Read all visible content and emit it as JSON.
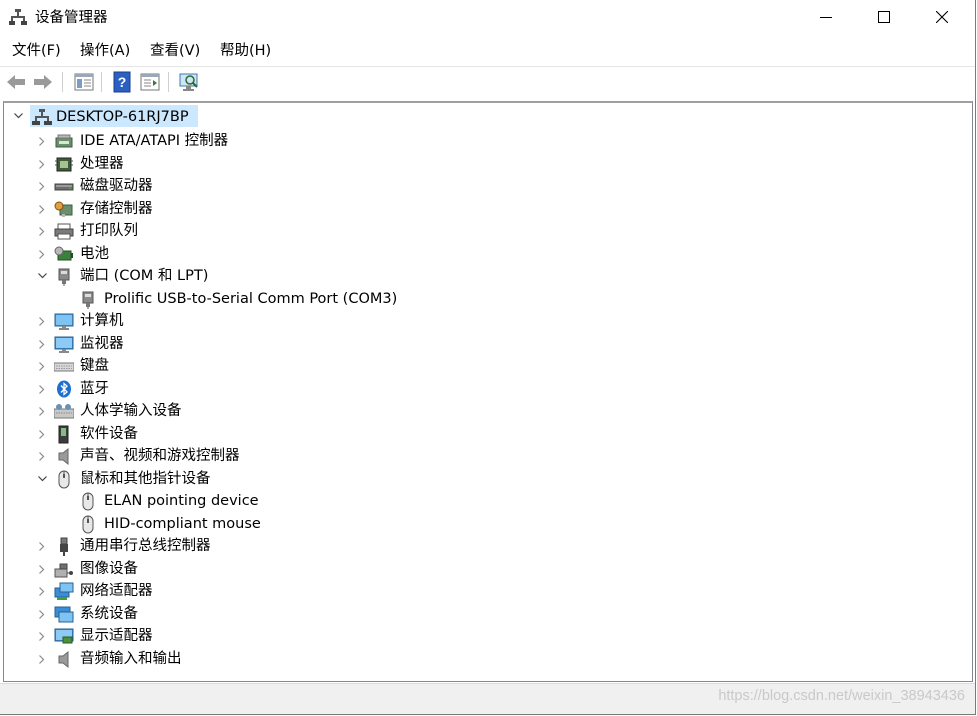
{
  "window": {
    "title": "设备管理器"
  },
  "menu": [
    "文件(F)",
    "操作(A)",
    "查看(V)",
    "帮助(H)"
  ],
  "toolbar": [
    {
      "name": "back-icon"
    },
    {
      "name": "forward-icon"
    },
    {
      "name": "properties-icon"
    },
    {
      "name": "help-icon"
    },
    {
      "name": "run-icon"
    },
    {
      "name": "scan-hardware-icon"
    }
  ],
  "tree": {
    "root": "DESKTOP-61RJ7BP",
    "items": [
      {
        "label": "IDE ATA/ATAPI 控制器",
        "icon": "ide-controller-icon",
        "expanded": false
      },
      {
        "label": "处理器",
        "icon": "processor-icon",
        "expanded": false
      },
      {
        "label": "磁盘驱动器",
        "icon": "disk-drive-icon",
        "expanded": false
      },
      {
        "label": "存储控制器",
        "icon": "storage-controller-icon",
        "expanded": false
      },
      {
        "label": "打印队列",
        "icon": "printer-icon",
        "expanded": false
      },
      {
        "label": "电池",
        "icon": "battery-icon",
        "expanded": false
      },
      {
        "label": "端口 (COM 和 LPT)",
        "icon": "port-icon",
        "expanded": true,
        "children": [
          {
            "label": "Prolific USB-to-Serial Comm Port (COM3)",
            "icon": "port-icon"
          }
        ]
      },
      {
        "label": "计算机",
        "icon": "computer-icon",
        "expanded": false
      },
      {
        "label": "监视器",
        "icon": "monitor-icon",
        "expanded": false
      },
      {
        "label": "键盘",
        "icon": "keyboard-icon",
        "expanded": false
      },
      {
        "label": "蓝牙",
        "icon": "bluetooth-icon",
        "expanded": false
      },
      {
        "label": "人体学输入设备",
        "icon": "hid-icon",
        "expanded": false
      },
      {
        "label": "软件设备",
        "icon": "software-device-icon",
        "expanded": false
      },
      {
        "label": "声音、视频和游戏控制器",
        "icon": "speaker-icon",
        "expanded": false
      },
      {
        "label": "鼠标和其他指针设备",
        "icon": "mouse-icon",
        "expanded": true,
        "children": [
          {
            "label": "ELAN pointing device",
            "icon": "mouse-icon"
          },
          {
            "label": "HID-compliant mouse",
            "icon": "mouse-icon"
          }
        ]
      },
      {
        "label": "通用串行总线控制器",
        "icon": "usb-icon",
        "expanded": false
      },
      {
        "label": "图像设备",
        "icon": "camera-icon",
        "expanded": false
      },
      {
        "label": "网络适配器",
        "icon": "network-icon",
        "expanded": false
      },
      {
        "label": "系统设备",
        "icon": "system-device-icon",
        "expanded": false
      },
      {
        "label": "显示适配器",
        "icon": "display-adapter-icon",
        "expanded": false
      },
      {
        "label": "音频输入和输出",
        "icon": "audio-io-icon",
        "expanded": false
      }
    ]
  },
  "watermark": "https://blog.csdn.net/weixin_38943436"
}
